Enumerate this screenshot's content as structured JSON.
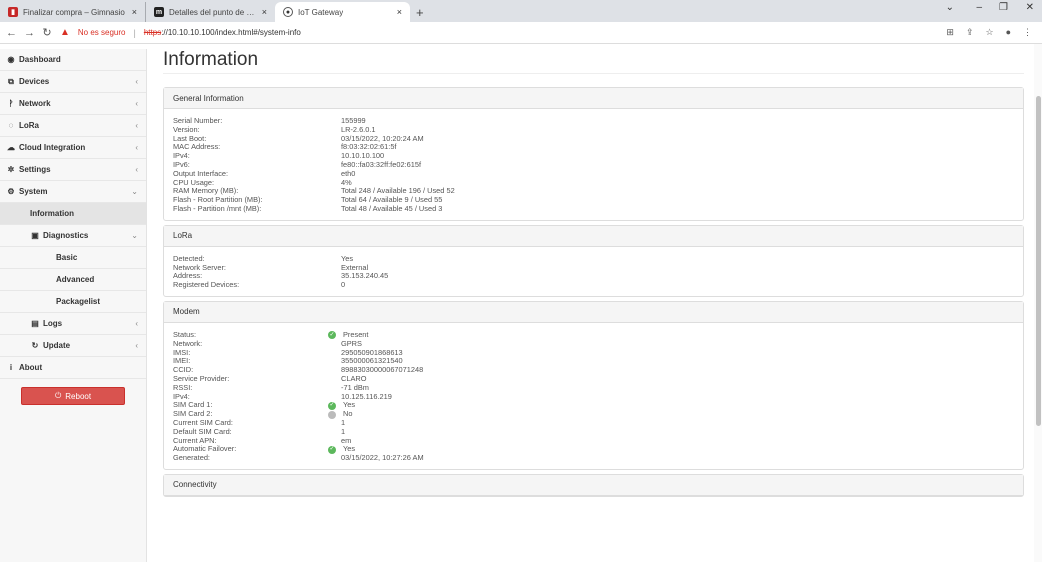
{
  "browser": {
    "tabs": [
      {
        "label": "Finalizar compra – Gimnasio",
        "close": "×",
        "color": "#c62828",
        "glyph": "▮"
      },
      {
        "label": "Detalles del punto de datos - Mc",
        "close": "×",
        "color": "#222222",
        "glyph": "m"
      },
      {
        "label": "IoT Gateway",
        "close": "×",
        "color": "#ffffff",
        "glyph": "◉"
      }
    ],
    "new_tab": "+",
    "insecure_label": "No es seguro",
    "url_scheme": "https",
    "url_rest": "://10.10.10.100/index.html#/system-info"
  },
  "sidebar": {
    "items": [
      {
        "label": "Dashboard",
        "icon": "tachometer-icon"
      },
      {
        "label": "Devices",
        "icon": "sitemap-icon"
      },
      {
        "label": "Network",
        "icon": "network-icon"
      },
      {
        "label": "LoRa",
        "icon": "radio-icon"
      },
      {
        "label": "Cloud Integration",
        "icon": "cloud-icon"
      },
      {
        "label": "Settings",
        "icon": "gear-icon"
      },
      {
        "label": "System",
        "icon": "cogs-icon"
      },
      {
        "label": "Information"
      },
      {
        "label": "Diagnostics",
        "icon": "medkit-icon"
      },
      {
        "label": "Basic"
      },
      {
        "label": "Advanced"
      },
      {
        "label": "Packagelist"
      },
      {
        "label": "Logs",
        "icon": "file-icon"
      },
      {
        "label": "Update",
        "icon": "refresh-icon"
      },
      {
        "label": "About",
        "icon": "info-icon"
      }
    ],
    "reboot_label": "Reboot",
    "reboot_color": "#d9534f"
  },
  "main": {
    "title": "Information",
    "general": {
      "heading": "General Information",
      "rows": [
        {
          "k": "Serial Number:",
          "v": "155999"
        },
        {
          "k": "Version:",
          "v": "LR-2.6.0.1"
        },
        {
          "k": "Last Boot:",
          "v": "03/15/2022, 10:20:24 AM"
        },
        {
          "k": "MAC Address:",
          "v": "f8:03:32:02:61:5f"
        },
        {
          "k": "IPv4:",
          "v": "10.10.10.100"
        },
        {
          "k": "IPv6:",
          "v": "fe80::fa03:32ff:fe02:615f"
        },
        {
          "k": "Output Interface:",
          "v": "eth0"
        },
        {
          "k": "CPU Usage:",
          "v": "4%"
        },
        {
          "k": "RAM Memory (MB):",
          "v": "Total 248 / Available 196 / Used 52"
        },
        {
          "k": "Flash - Root Partition (MB):",
          "v": "Total 64 / Available 9 / Used 55"
        },
        {
          "k": "Flash - Partition /mnt (MB):",
          "v": "Total 48 / Available 45 / Used 3"
        }
      ]
    },
    "lora": {
      "heading": "LoRa",
      "rows": [
        {
          "k": "Detected:",
          "v": "Yes"
        },
        {
          "k": "Network Server:",
          "v": "External"
        },
        {
          "k": "Address:",
          "v": "35.153.240.45"
        },
        {
          "k": "Registered Devices:",
          "v": "0"
        }
      ]
    },
    "modem": {
      "heading": "Modem",
      "rows": [
        {
          "k": "Status:",
          "v": "Present",
          "status": "ok"
        },
        {
          "k": "Network:",
          "v": "GPRS"
        },
        {
          "k": "IMSI:",
          "v": "295050901868613"
        },
        {
          "k": "IMEI:",
          "v": "355000061321540"
        },
        {
          "k": "CCID:",
          "v": "89883030000067071248"
        },
        {
          "k": "Service Provider:",
          "v": "CLARO"
        },
        {
          "k": "RSSI:",
          "v": "-71 dBm"
        },
        {
          "k": "IPv4:",
          "v": "10.125.116.219"
        },
        {
          "k": "SIM Card 1:",
          "v": "Yes",
          "status": "ok"
        },
        {
          "k": "SIM Card 2:",
          "v": "No",
          "status": "off"
        },
        {
          "k": "Current SIM Card:",
          "v": "1"
        },
        {
          "k": "Default SIM Card:",
          "v": "1"
        },
        {
          "k": "Current APN:",
          "v": "em"
        },
        {
          "k": "Automatic Failover:",
          "v": "Yes",
          "status": "ok"
        },
        {
          "k": "Generated:",
          "v": "03/15/2022, 10:27:26 AM"
        }
      ]
    },
    "connectivity": {
      "heading": "Connectivity"
    }
  }
}
